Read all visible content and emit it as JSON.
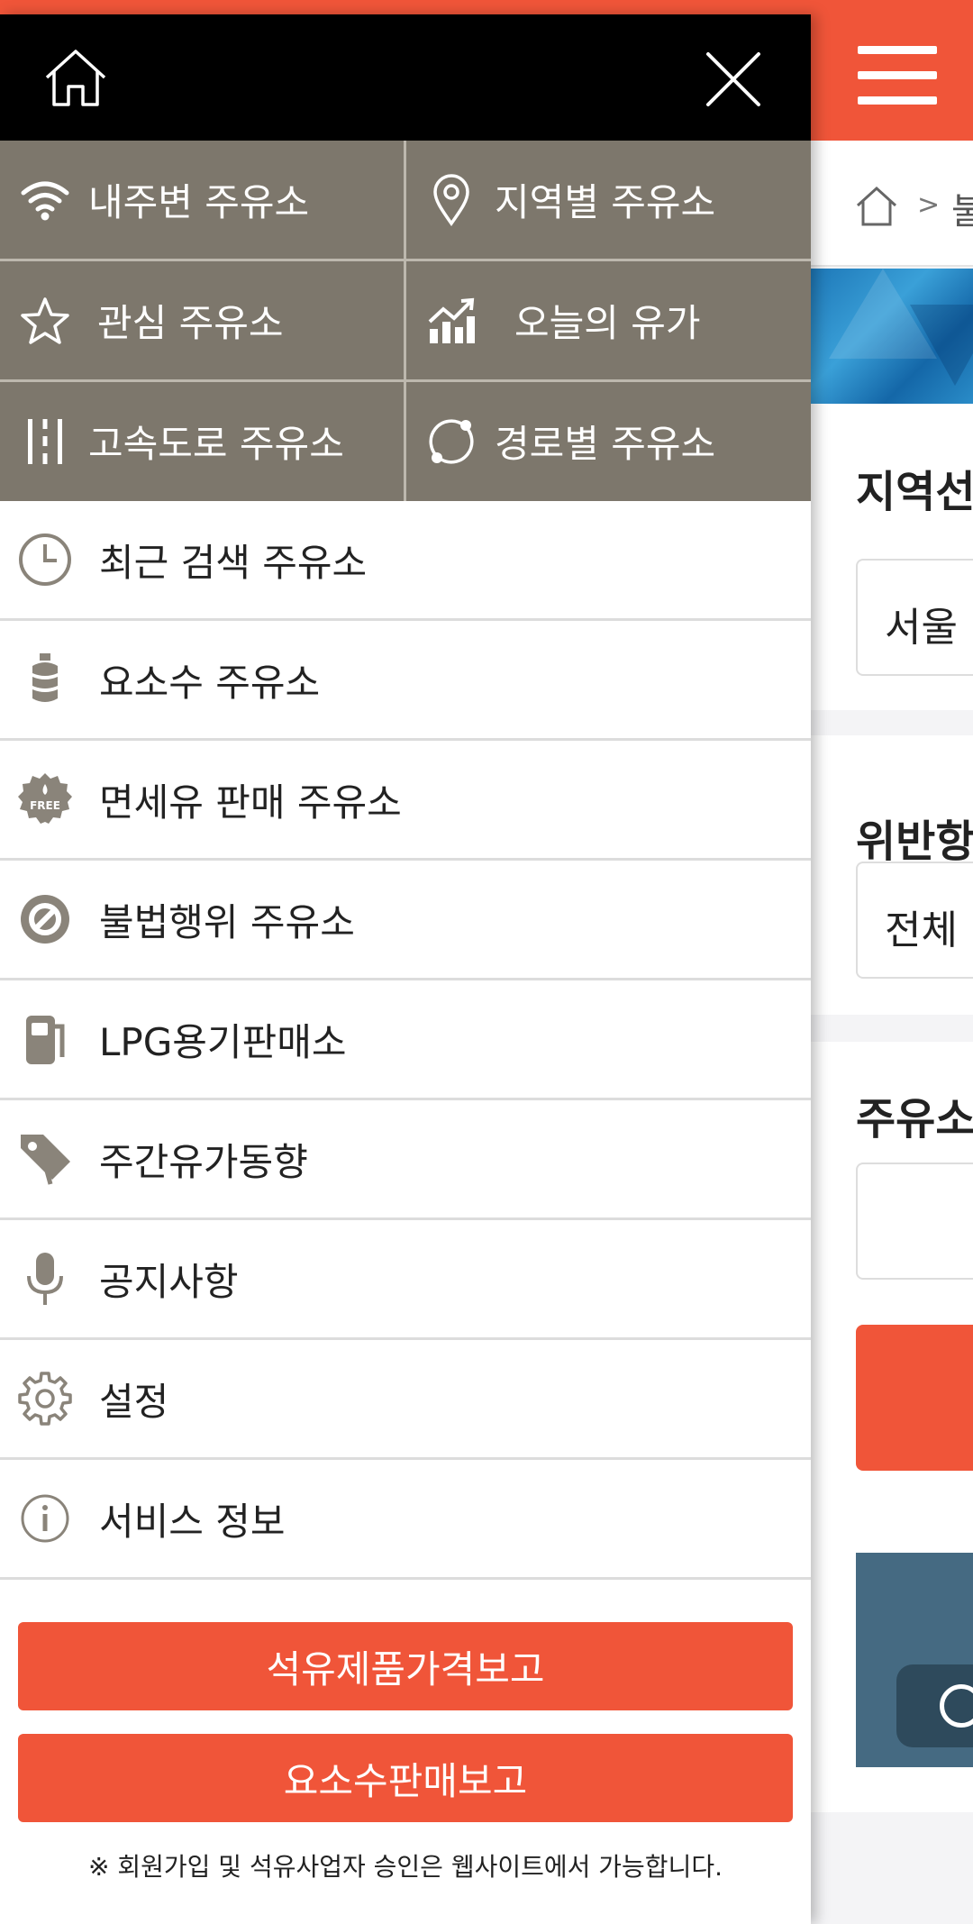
{
  "colors": {
    "accent": "#f05539",
    "grid_bg": "#7d776c",
    "header_bg": "#000000"
  },
  "drawer": {
    "header": {
      "home_icon": "home-icon",
      "close_icon": "close-icon"
    },
    "grid": [
      {
        "label": "내주변 주유소",
        "icon": "wifi-icon"
      },
      {
        "label": "지역별 주유소",
        "icon": "location-pin-icon"
      },
      {
        "label": "관심 주유소",
        "icon": "star-icon"
      },
      {
        "label": "오늘의 유가",
        "icon": "price-chart-icon"
      },
      {
        "label": "고속도로 주유소",
        "icon": "highway-icon"
      },
      {
        "label": "경로별 주유소",
        "icon": "route-icon"
      }
    ],
    "menu": [
      {
        "label": "최근 검색 주유소",
        "icon": "clock-icon"
      },
      {
        "label": "요소수 주유소",
        "icon": "urea-bottle-icon"
      },
      {
        "label": "면세유 판매 주유소",
        "icon": "free-badge-icon"
      },
      {
        "label": "불법행위 주유소",
        "icon": "prohibited-icon"
      },
      {
        "label": "LPG용기판매소",
        "icon": "gas-pump-icon"
      },
      {
        "label": "주간유가동향",
        "icon": "tag-icon"
      },
      {
        "label": "공지사항",
        "icon": "microphone-icon"
      },
      {
        "label": "설정",
        "icon": "gear-icon"
      },
      {
        "label": "서비스 정보",
        "icon": "info-icon"
      }
    ],
    "buttons": {
      "report_price": "석유제품가격보고",
      "report_urea": "요소수판매보고"
    },
    "note": "※ 회원가입 및 석유사업자 승인은 웹사이트에서 가능합니다."
  },
  "background": {
    "breadcrumb_text": "불",
    "section1_label": "지역선",
    "section1_value": "서울",
    "section2_label": "위반항",
    "section2_value": "전체",
    "section3_label": "주유소"
  }
}
